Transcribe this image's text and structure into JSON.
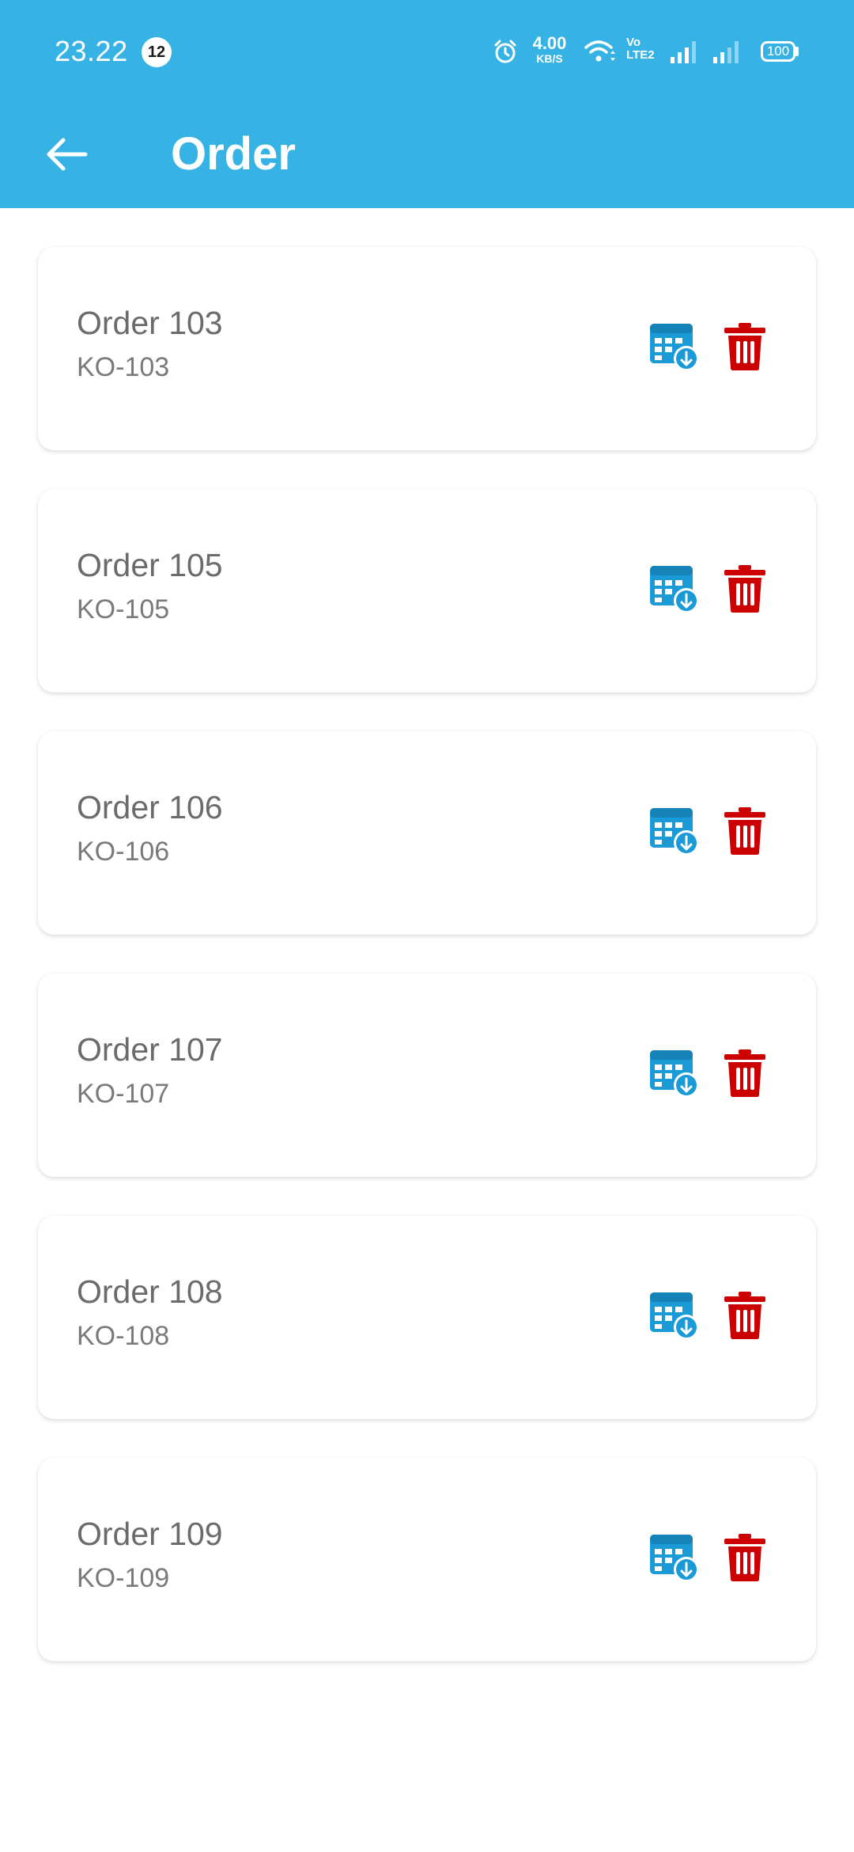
{
  "status_bar": {
    "time": "23.22",
    "notification_count": "12",
    "net_speed_value": "4.00",
    "net_speed_unit": "KB/S",
    "volte_label": "Vo",
    "lte_label": "LTE2",
    "battery_level": "100",
    "icons": [
      "alarm-icon",
      "wifi-icon",
      "volte-icon",
      "signal-icon",
      "signal-icon",
      "battery-icon"
    ]
  },
  "appbar": {
    "title": "Order",
    "back_icon": "arrow-left-icon",
    "background_color": "#36b3e4"
  },
  "orders": [
    {
      "name": "Order 103",
      "code": "KO-103"
    },
    {
      "name": "Order 105",
      "code": "KO-105"
    },
    {
      "name": "Order 106",
      "code": "KO-106"
    },
    {
      "name": "Order 107",
      "code": "KO-107"
    },
    {
      "name": "Order 108",
      "code": "KO-108"
    },
    {
      "name": "Order 109",
      "code": "KO-109"
    }
  ],
  "actions": {
    "download_icon": "table-download-icon",
    "download_color": "#1a9ad6",
    "delete_icon": "trash-icon",
    "delete_color": "#cc0000"
  }
}
